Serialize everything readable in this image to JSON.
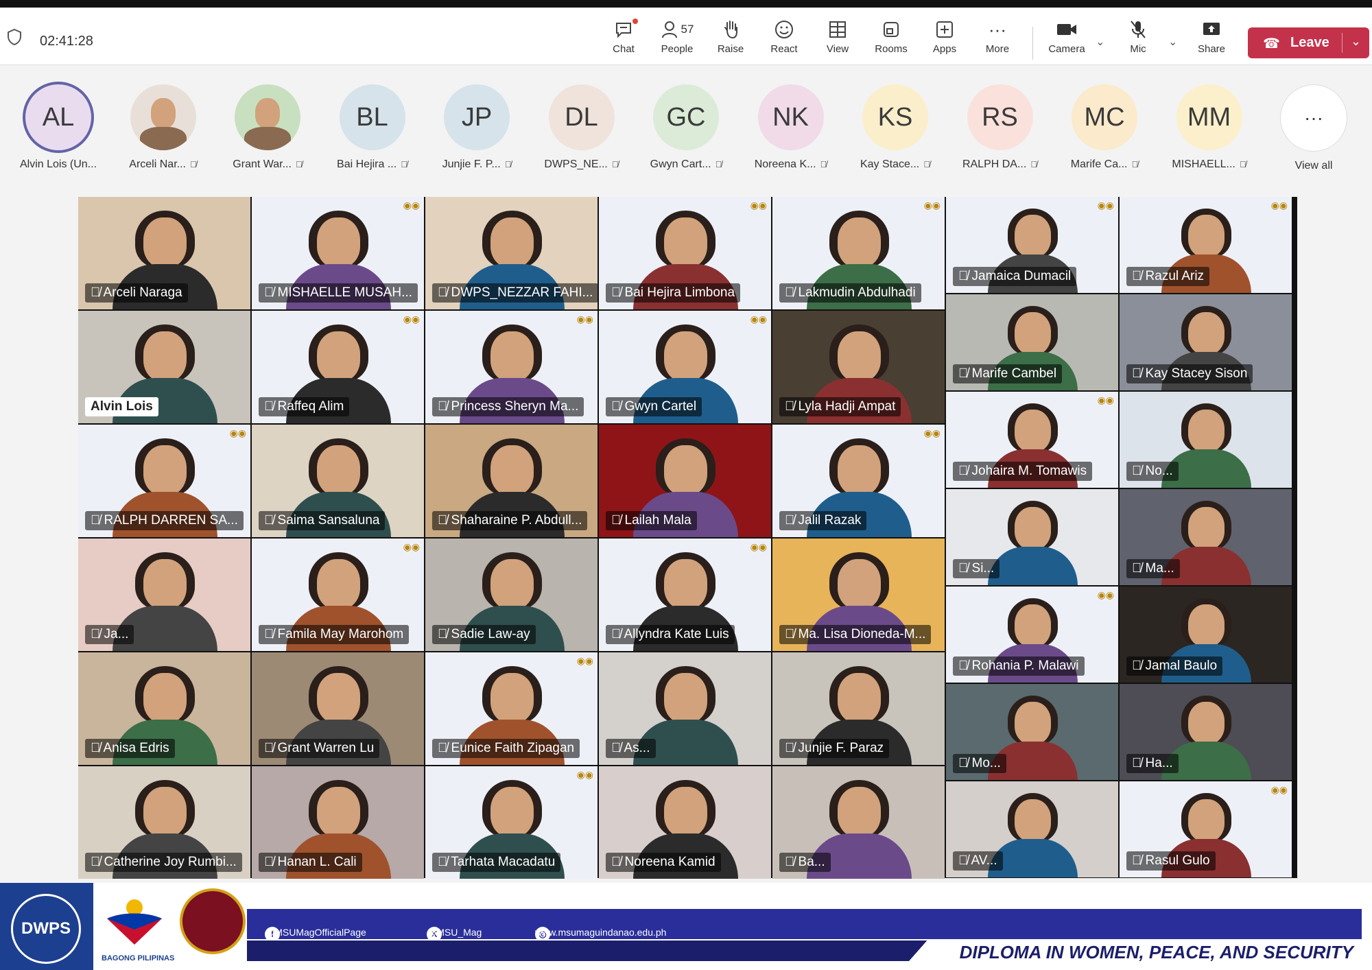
{
  "meeting": {
    "timer": "02:41:28"
  },
  "toolbar": {
    "chat": "Chat",
    "people": "People",
    "people_count": "57",
    "raise": "Raise",
    "react": "React",
    "view": "View",
    "rooms": "Rooms",
    "apps": "Apps",
    "more": "More",
    "camera": "Camera",
    "mic": "Mic",
    "share": "Share",
    "leave": "Leave"
  },
  "participants": [
    {
      "initials": "AL",
      "name": "Alvin Lois (Un...",
      "color": "#e9dcef",
      "selected": true
    },
    {
      "initials": "",
      "name": "Arceli Nar...",
      "color": "#e8e0d8",
      "photo": true
    },
    {
      "initials": "",
      "name": "Grant War...",
      "color": "#c8e0c0",
      "photo": true
    },
    {
      "initials": "BL",
      "name": "Bai Hejira ...",
      "color": "#d6e3ea"
    },
    {
      "initials": "JP",
      "name": "Junjie F. P...",
      "color": "#d6e3ea"
    },
    {
      "initials": "DL",
      "name": "DWPS_NE...",
      "color": "#efe3dc"
    },
    {
      "initials": "GC",
      "name": "Gwyn Cart...",
      "color": "#dcebd8"
    },
    {
      "initials": "NK",
      "name": "Noreena K...",
      "color": "#f1dbe8"
    },
    {
      "initials": "KS",
      "name": "Kay Stace...",
      "color": "#fbeecb"
    },
    {
      "initials": "RS",
      "name": "RALPH DA...",
      "color": "#fbe1dc"
    },
    {
      "initials": "MC",
      "name": "Marife Ca...",
      "color": "#fbeacb"
    },
    {
      "initials": "MM",
      "name": "MISHAELL...",
      "color": "#fbf0cb"
    }
  ],
  "view_all": "View all",
  "tiles": [
    {
      "name": "Arceli  Naraga",
      "bg": "#d9c6ad"
    },
    {
      "name": "MISHAELLE MUSAH...",
      "bg": "#eef0f7"
    },
    {
      "name": "DWPS_NEZZAR FAHI...",
      "bg": "#e3d2bd"
    },
    {
      "name": "Bai Hejira Limbona",
      "bg": "#eef0f7"
    },
    {
      "name": "Lakmudin Abdulhadi",
      "bg": "#eef0f7"
    },
    {
      "name": "Jamaica Dumacil",
      "bg": "#eef0f7"
    },
    {
      "name": "Razul Ariz",
      "bg": "#eef0f7"
    },
    {
      "name": "Alvin Lois",
      "bg": "#c9c4bb"
    },
    {
      "name": "Raffeq Alim",
      "bg": "#eef0f7"
    },
    {
      "name": "Princess Sheryn Ma...",
      "bg": "#eef0f7"
    },
    {
      "name": "Gwyn Cartel",
      "bg": "#eef0f7"
    },
    {
      "name": "Lyla Hadji Ampat",
      "bg": "#4a3f33"
    },
    {
      "name": "Marife Cambel",
      "bg": "#b9b9b4"
    },
    {
      "name": "Kay Stacey Sison",
      "bg": "#8b8f99"
    },
    {
      "name": "RALPH DARREN SA...",
      "bg": "#eef0f7"
    },
    {
      "name": "Saima Sansaluna",
      "bg": "#ded4c4"
    },
    {
      "name": "Shaharaine P. Abdull...",
      "bg": "#c9a882"
    },
    {
      "name": "Lailah Mala",
      "bg": "#8e1418"
    },
    {
      "name": "Jalil Razak",
      "bg": "#eef0f7"
    },
    {
      "name": "Johaira M. Tomawis",
      "bg": "#eef0f7"
    },
    {
      "name": "No...",
      "bg": "#dde3ea"
    },
    {
      "name": "Ja...",
      "bg": "#e6ccc4"
    },
    {
      "name": "Famila May Marohom",
      "bg": "#eef0f7"
    },
    {
      "name": "Sadie Law-ay",
      "bg": "#b9b4ad"
    },
    {
      "name": "Allyndra Kate Luis",
      "bg": "#eef0f7"
    },
    {
      "name": "Ma. Lisa Dioneda-M...",
      "bg": "#e8b45a"
    },
    {
      "name": "Si...",
      "bg": "#e6e8ec"
    },
    {
      "name": "Ma...",
      "bg": "#60626e"
    },
    {
      "name": "Anisa Edris",
      "bg": "#c9b59c"
    },
    {
      "name": "Grant Warren Lu",
      "bg": "#9c8a75"
    },
    {
      "name": "Eunice Faith Zipagan",
      "bg": "#eef0f7"
    },
    {
      "name": "As...",
      "bg": "#d4d0cc"
    },
    {
      "name": "Junjie F. Paraz",
      "bg": "#c8c4bc"
    },
    {
      "name": "Rohania P. Malawi",
      "bg": "#eef0f7"
    },
    {
      "name": "Jamal Baulo",
      "bg": "#2c2622"
    },
    {
      "name": "Mo...",
      "bg": "#5a6a6e"
    },
    {
      "name": "Ha...",
      "bg": "#4e4c54"
    },
    {
      "name": "Catherine Joy Rumbi...",
      "bg": "#d9d0c4"
    },
    {
      "name": "Hanan L. Cali",
      "bg": "#b6a9a7"
    },
    {
      "name": "Tarhata Macadatu",
      "bg": "#eef0f7"
    },
    {
      "name": "Noreena Kamid",
      "bg": "#d8cfcc"
    },
    {
      "name": "Ba...",
      "bg": "#c8c0b8"
    },
    {
      "name": "AV...",
      "bg": "#d4cfcb"
    },
    {
      "name": "Rasul Gulo",
      "bg": "#eef0f7"
    }
  ],
  "banner": {
    "logo_text": "DWPS",
    "bagong": "BAGONG PILIPINAS",
    "facebook": "@MSUMagOfficialPage",
    "x": "@MSU_Mag",
    "web": "www.msumaguindanao.edu.ph",
    "title": "DIPLOMA IN WOMEN, PEACE, AND SECURITY"
  }
}
